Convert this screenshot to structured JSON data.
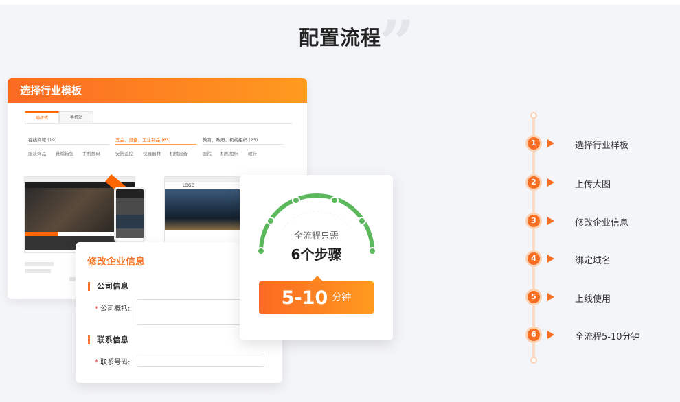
{
  "section": {
    "title": "配置流程"
  },
  "template_card": {
    "header": "选择行业模板",
    "tabs": [
      "响应式",
      "手机站"
    ],
    "categories": [
      {
        "label": "在线商城 (19)",
        "subs": [
          "服装饰品",
          "鞋帽箱包",
          "手机数码"
        ]
      },
      {
        "label": "五金、设备、工业制品 (63)",
        "subs": [
          "安防监控",
          "仪器器材",
          "机械设备"
        ]
      },
      {
        "label": "教育、政府、机构组织 (23)",
        "subs": [
          "医院",
          "机构组织",
          "政府"
        ]
      }
    ],
    "thumb_logo": "LOGO"
  },
  "info_card": {
    "title": "修改企业信息",
    "section1": "公司信息",
    "field1_label": "公司概括:",
    "section2": "联系信息",
    "field2_label": "联系号码:"
  },
  "gauge_card": {
    "subtitle": "全流程只需",
    "main": "6个步骤",
    "duration_value": "5-10",
    "duration_unit": "分钟"
  },
  "steps": [
    {
      "num": "1",
      "label": "选择行业样板"
    },
    {
      "num": "2",
      "label": "上传大图"
    },
    {
      "num": "3",
      "label": "修改企业信息"
    },
    {
      "num": "4",
      "label": "绑定域名"
    },
    {
      "num": "5",
      "label": "上线使用"
    },
    {
      "num": "6",
      "label": "全流程5-10分钟"
    }
  ],
  "colors": {
    "accent": "#f86f23",
    "accent_light": "#ff9a1f",
    "gauge_green": "#5cb85c",
    "timeline": "#fcd9c3"
  }
}
